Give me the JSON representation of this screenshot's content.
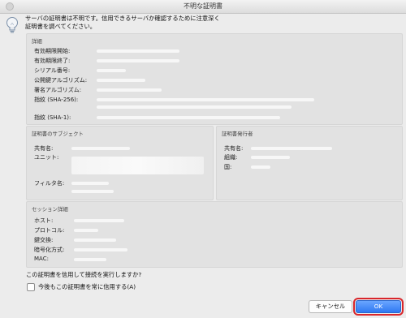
{
  "window": {
    "title": "不明な証明書"
  },
  "message": {
    "line1": "サーバの証明書は不明です。信用できるサーバか確認するために注意深く",
    "line2": "証明書を調べてください。"
  },
  "details": {
    "header": "詳細",
    "labels": [
      "有効期限開始:",
      "有効期限終了:",
      "シリアル番号:",
      "公開鍵アルゴリズム:",
      "署名アルゴリズム:",
      "指紋 (SHA-256):",
      "指紋 (SHA-1):"
    ]
  },
  "subject": {
    "header": "証明書のサブジェクト",
    "common_name_label": "共有名:",
    "unit_label": "ユニット:",
    "filter_label": "フィルタ名:"
  },
  "issuer": {
    "header": "証明書発行者",
    "common_name_label": "共有名:",
    "org_label": "組織:",
    "country_label": "国:"
  },
  "session": {
    "header": "セッション詳細",
    "host_label": "ホスト:",
    "protocol_label": "プロトコル:",
    "key_exchange_label": "鍵交換:",
    "cipher_label": "暗号化方式:",
    "mac_label": "MAC:"
  },
  "question": "この証明書を信用して接続を実行しますか?",
  "trust_checkbox": {
    "label": "今後もこの証明書を常に信用する(A)",
    "checked": false
  },
  "buttons": {
    "cancel": "キャンセル",
    "ok": "OK"
  },
  "colors": {
    "accent": "#2f78f2",
    "highlight": "#d9262b"
  }
}
